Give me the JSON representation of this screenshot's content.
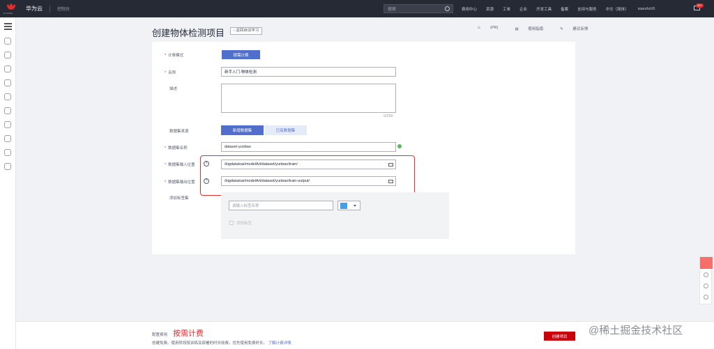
{
  "topbar": {
    "logo_text": "HUAWEI",
    "brand": "华为云",
    "console": "控制台",
    "search_placeholder": "搜索",
    "links": [
      "费用中心",
      "资源",
      "工单",
      "企业",
      "开发工具",
      "备案",
      "支持与服务",
      "中文（简体）",
      "xiaozhch5"
    ],
    "mail_badge": "99+"
  },
  "header": {
    "title": "创建物体检测项目",
    "back_label": "返回自动学习",
    "tools": [
      "(PR)",
      "使用指南",
      "建议反馈"
    ]
  },
  "form": {
    "billing_label": "计费模式",
    "billing_value": "按需计费",
    "name_label": "名称",
    "name_value": "新手入门-物体检测",
    "desc_label": "描述",
    "desc_counter": "0/256",
    "source_label": "数据集来源",
    "source_options": [
      "新增数据集",
      "已有数据集"
    ],
    "dataset_name_label": "数据集名称",
    "dataset_name_value": "dataset-yunbao",
    "input_label": "数据集输入位置",
    "input_value": "/bigdatatoai/modelArt/dataset/yunbao/train/",
    "output_label": "数据集输出位置",
    "output_value": "/bigdatatoai/modelArt/dataset/yunbao/train-output/",
    "tags_label": "添加标签集",
    "tag_placeholder": "请输入标签名称",
    "tag_color": "#3fa0f0",
    "add_tag": "添加标签"
  },
  "footer": {
    "config_label": "配置费用",
    "price": "按需计费",
    "desc": "创建免费。使用阶段按训练及部署的时长收费。优先使用免费时长。",
    "detail_link": "了解计费详情",
    "create_button": "创建项目"
  },
  "watermark": "@稀土掘金技术社区"
}
